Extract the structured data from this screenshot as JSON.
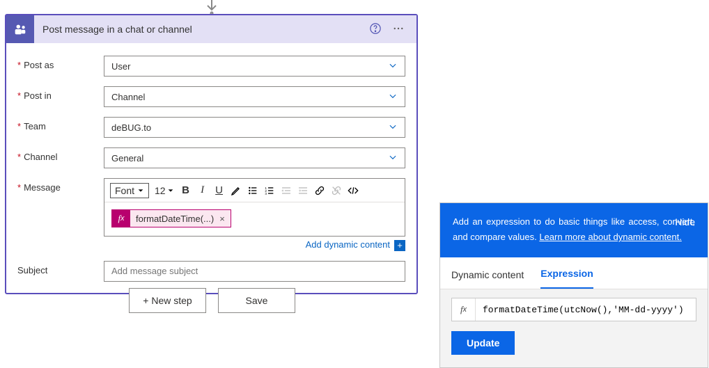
{
  "card": {
    "title": "Post message in a chat or channel",
    "fields": {
      "postAs": {
        "label": "Post as",
        "value": "User"
      },
      "postIn": {
        "label": "Post in",
        "value": "Channel"
      },
      "team": {
        "label": "Team",
        "value": "deBUG.to"
      },
      "channel": {
        "label": "Channel",
        "value": "General"
      },
      "message": {
        "label": "Message"
      },
      "subject": {
        "label": "Subject",
        "placeholder": "Add message subject"
      }
    },
    "toolbar": {
      "font_label": "Font",
      "size_value": "12"
    },
    "token": {
      "label": "formatDateTime(...)"
    },
    "addDynamic": "Add dynamic content"
  },
  "footer": {
    "newStep": "+ New step",
    "save": "Save"
  },
  "panel": {
    "hint": "Add an expression to do basic things like access, convert, and compare values.",
    "learn": "Learn more about dynamic content.",
    "hide": "Hide",
    "tabs": {
      "dynamic": "Dynamic content",
      "expression": "Expression"
    },
    "expression": "formatDateTime(utcNow(),'MM-dd-yyyy')",
    "update": "Update"
  }
}
